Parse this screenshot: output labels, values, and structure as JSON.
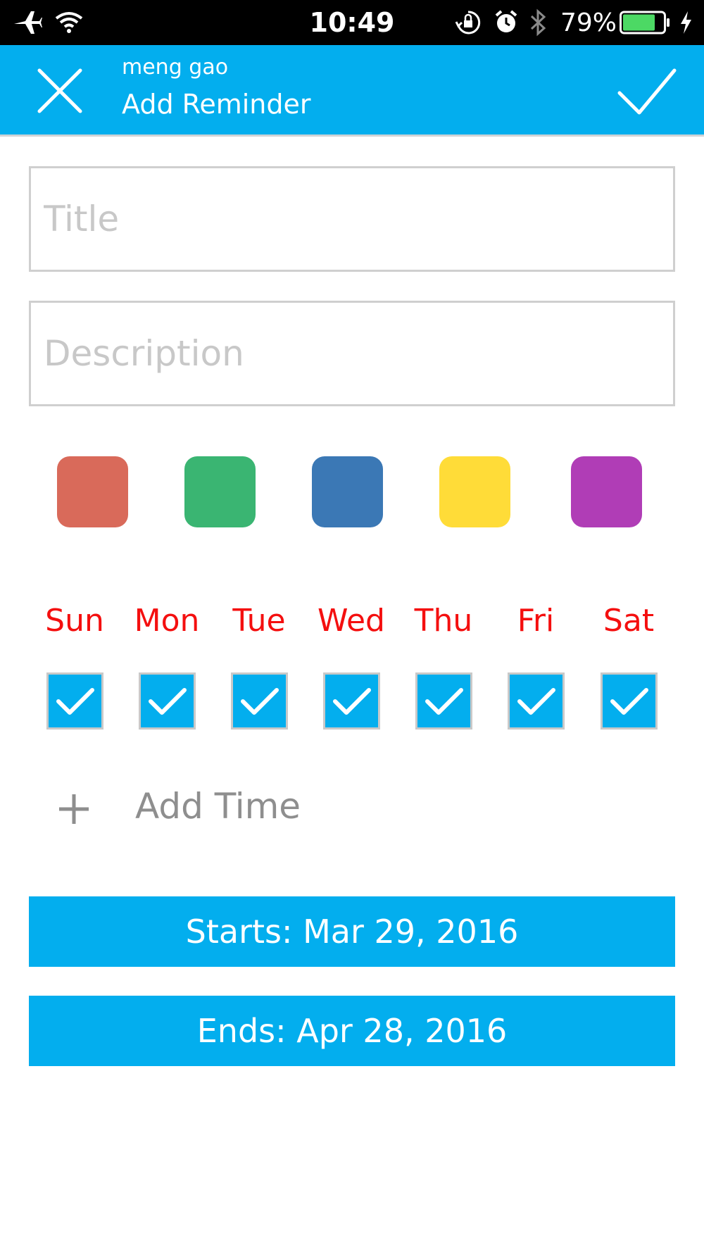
{
  "status_bar": {
    "time": "10:49",
    "battery_percent": "79%",
    "battery_level": 0.79,
    "icons": [
      "airplane-icon",
      "wifi-icon",
      "orientation-lock-icon",
      "alarm-icon",
      "bluetooth-icon",
      "battery-icon",
      "charging-icon"
    ]
  },
  "header": {
    "subtitle": "meng gao",
    "title": "Add Reminder",
    "close_icon": "close-icon",
    "confirm_icon": "checkmark-icon"
  },
  "form": {
    "title_placeholder": "Title",
    "title_value": "",
    "description_placeholder": "Description",
    "description_value": ""
  },
  "colors": [
    {
      "name": "red",
      "hex": "#d96a5a"
    },
    {
      "name": "green",
      "hex": "#3ab572"
    },
    {
      "name": "blue",
      "hex": "#3b78b5"
    },
    {
      "name": "yellow",
      "hex": "#ffdc38"
    },
    {
      "name": "purple",
      "hex": "#b03db6"
    }
  ],
  "days": [
    {
      "label": "Sun",
      "checked": true
    },
    {
      "label": "Mon",
      "checked": true
    },
    {
      "label": "Tue",
      "checked": true
    },
    {
      "label": "Wed",
      "checked": true
    },
    {
      "label": "Thu",
      "checked": true
    },
    {
      "label": "Fri",
      "checked": true
    },
    {
      "label": "Sat",
      "checked": true
    }
  ],
  "add_time": {
    "label": "Add Time",
    "icon": "plus-icon"
  },
  "dates": {
    "starts_label": "Starts: Mar 29, 2016",
    "ends_label": "Ends: Apr 28, 2016"
  },
  "theme": {
    "accent": "#03aeee",
    "day_label_color": "#f40f0f"
  }
}
